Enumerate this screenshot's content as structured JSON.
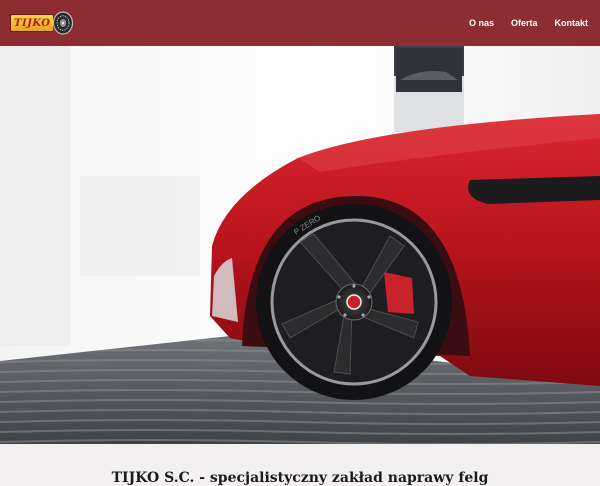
{
  "header": {
    "logo_text": "TIJKO",
    "nav": [
      {
        "label": "O nas"
      },
      {
        "label": "Oferta"
      },
      {
        "label": "Kontakt"
      }
    ]
  },
  "hero": {
    "image": "red sports car front wheel on carpet",
    "tire_text": "P ZERO"
  },
  "intro": {
    "tagline": "TIJKO S.C. - specjalistyczny zakład naprawy felg"
  },
  "colors": {
    "header_bg": "#8e2c34",
    "accent": "#c8232b",
    "page_bg": "#f2f0f0"
  }
}
